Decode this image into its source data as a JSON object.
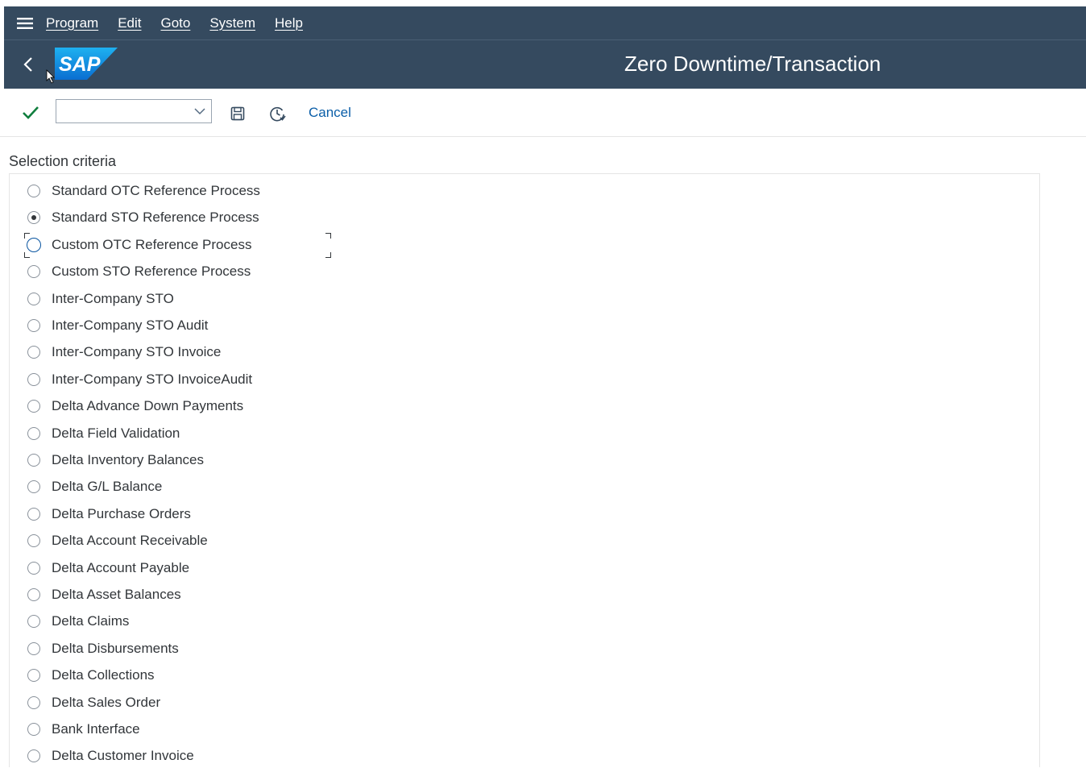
{
  "menu": {
    "items": [
      "Program",
      "Edit",
      "Goto",
      "System",
      "Help"
    ]
  },
  "header": {
    "logo": "SAP",
    "title": "Zero Downtime/Transaction"
  },
  "toolbar": {
    "command_field_value": "",
    "cancel_label": "Cancel"
  },
  "selection": {
    "title": "Selection criteria",
    "selected_index": 1,
    "focused_index": 2,
    "options": [
      "Standard OTC Reference Process",
      "Standard STO Reference Process",
      "Custom OTC Reference Process",
      "Custom STO Reference Process",
      "Inter-Company STO",
      "Inter-Company STO Audit",
      "Inter-Company STO Invoice",
      "Inter-Company STO InvoiceAudit",
      "Delta Advance Down Payments",
      "Delta Field Validation",
      "Delta Inventory Balances",
      "Delta G/L Balance",
      "Delta Purchase Orders",
      "Delta Account Receivable",
      "Delta Account Payable",
      "Delta Asset Balances",
      "Delta Claims",
      "Delta Disbursements",
      "Delta Collections",
      "Delta Sales Order",
      "Bank Interface",
      "Delta Customer Invoice"
    ]
  },
  "colors": {
    "shell": "#354a5f",
    "link": "#0a5ea8",
    "check": "#107e3e",
    "text": "#32363a"
  }
}
